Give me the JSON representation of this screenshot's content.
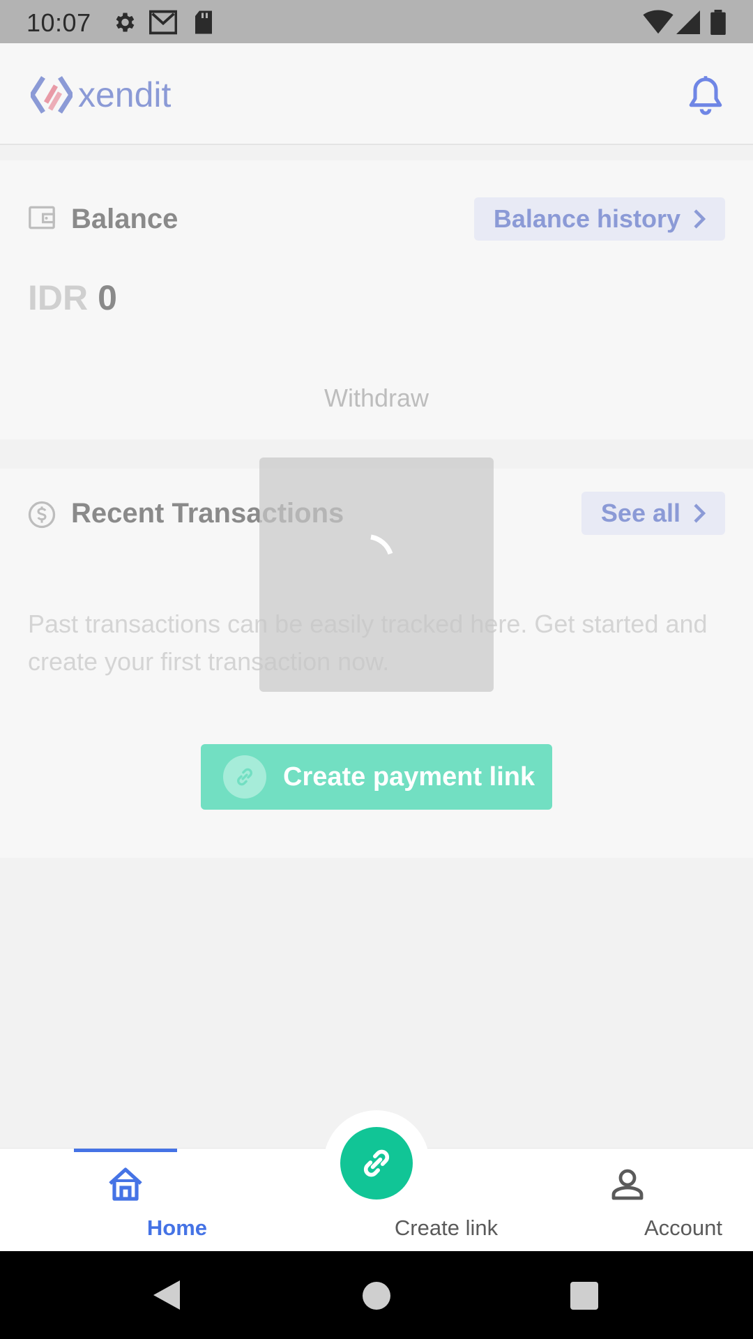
{
  "status_bar": {
    "time": "10:07",
    "left_icons": [
      "gear-icon",
      "gmail-icon",
      "sd-card-icon"
    ],
    "right_icons": [
      "wifi-icon",
      "cell-signal-icon",
      "battery-icon"
    ]
  },
  "app_bar": {
    "logo_text": "xendit",
    "notification_icon": "bell-icon"
  },
  "balance": {
    "title": "Balance",
    "history_button": "Balance history",
    "currency": "IDR",
    "amount": "0",
    "withdraw_label": "Withdraw"
  },
  "transactions": {
    "title": "Recent Transactions",
    "see_all_button": "See all",
    "empty_message": "Past transactions can be easily tracked here. Get started and create your first transaction now.",
    "create_button": "Create payment link"
  },
  "bottom_nav": {
    "items": [
      {
        "label": "Home",
        "icon": "home-icon",
        "active": true
      },
      {
        "label": "Create link",
        "icon": "link-icon",
        "active": false
      },
      {
        "label": "Account",
        "icon": "person-icon",
        "active": false
      }
    ]
  },
  "colors": {
    "accent_blue": "#4573e5",
    "brand_green": "#11c596",
    "logo_blue": "#8b9ad6"
  }
}
